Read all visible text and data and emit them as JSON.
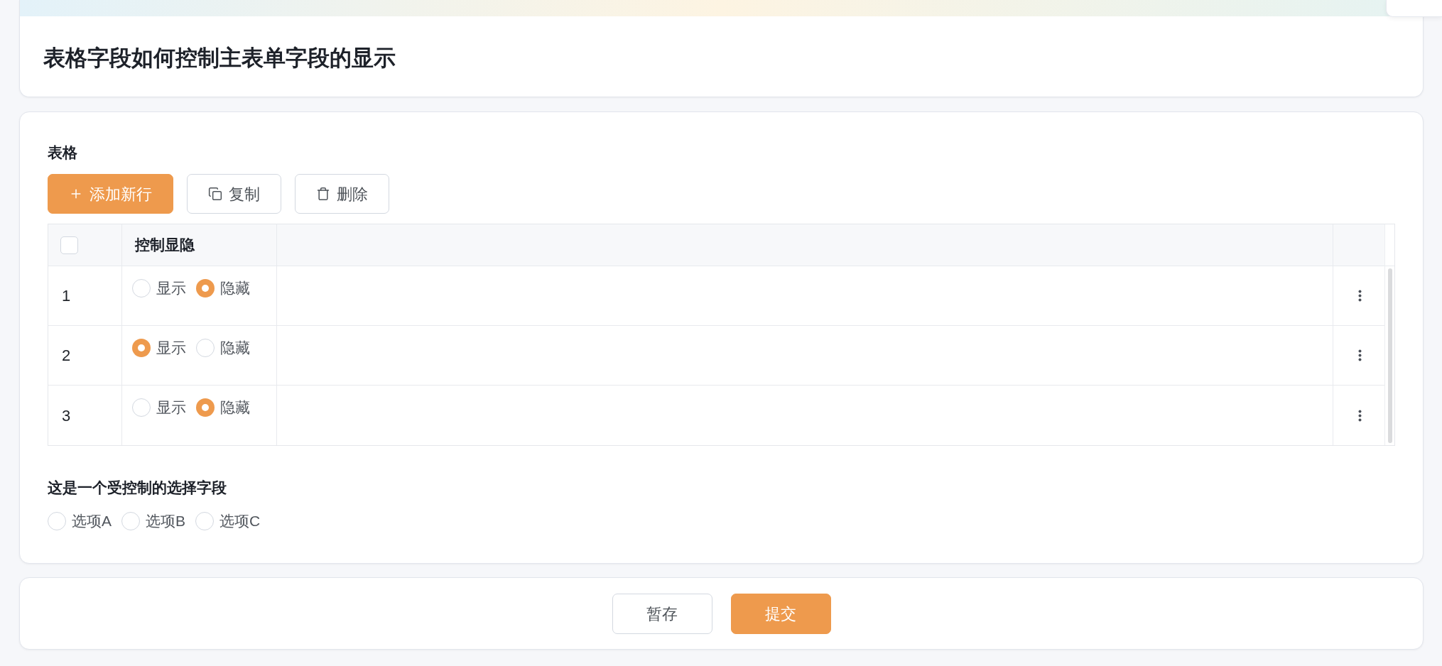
{
  "header": {
    "title": "表格字段如何控制主表单字段的显示"
  },
  "table_field": {
    "label": "表格",
    "toolbar": [
      {
        "kind": "add",
        "label": "添加新行"
      },
      {
        "kind": "copy",
        "label": "复制"
      },
      {
        "kind": "delete",
        "label": "删除"
      }
    ],
    "table": {
      "select_all": {
        "checked": false
      },
      "columns": [
        "控制显隐"
      ],
      "rows": [
        {
          "number": "1",
          "options": [
            {
              "label": "显示",
              "selected": false
            },
            {
              "label": "隐藏",
              "selected": true
            }
          ]
        },
        {
          "number": "2",
          "options": [
            {
              "label": "显示",
              "selected": true
            },
            {
              "label": "隐藏",
              "selected": false
            }
          ]
        },
        {
          "number": "3",
          "options": [
            {
              "label": "显示",
              "selected": false
            },
            {
              "label": "隐藏",
              "selected": true
            }
          ]
        }
      ]
    }
  },
  "controlled_field": {
    "label": "这是一个受控制的选择字段",
    "options": [
      {
        "label": "选项A",
        "selected": false
      },
      {
        "label": "选项B",
        "selected": false
      },
      {
        "label": "选项C",
        "selected": false
      }
    ]
  },
  "footer": {
    "buttons": [
      {
        "kind": "save_draft",
        "label": "暂存"
      },
      {
        "kind": "submit",
        "label": "提交"
      }
    ]
  }
}
